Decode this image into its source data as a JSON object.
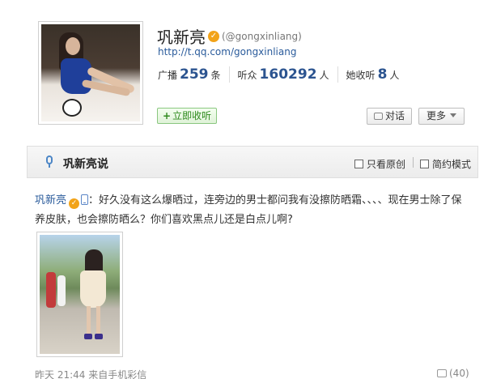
{
  "profile": {
    "name": "巩新亮",
    "handle": "(@gongxinliang)",
    "url": "http://t.qq.com/gongxinliang",
    "stats": [
      {
        "label": "广播",
        "value": "259",
        "unit": "条"
      },
      {
        "label": "听众",
        "value": "160292",
        "unit": "人"
      },
      {
        "label": "她收听",
        "value": "8",
        "unit": "人"
      }
    ],
    "follow_label": "立即收听",
    "talk_label": "对话",
    "more_label": "更多"
  },
  "bar": {
    "title": "巩新亮说",
    "original_only": "只看原创",
    "simple_mode": "简约模式"
  },
  "post": {
    "author": "巩新亮",
    "text": "：好久没有这么爆晒过，连旁边的男士都问我有没擦防晒霜、、、、现在男士除了保养皮肤，也会擦防晒么？你们喜欢黑点儿还是白点儿啊?",
    "time": "昨天 21:44",
    "source": "来自手机彩信",
    "comment_count": "(40)"
  },
  "colors": {
    "link": "#2a5b9b",
    "stat_number": "#2c5490",
    "verified_badge": "#f2a318",
    "follow_green": "#2f8a1e"
  },
  "icons": {
    "verified": "verified-badge-icon",
    "mic": "microphone-icon",
    "phone": "mobile-phone-icon",
    "talk": "chat-bubble-icon",
    "more": "chevron-down-icon",
    "comment": "comment-icon"
  }
}
